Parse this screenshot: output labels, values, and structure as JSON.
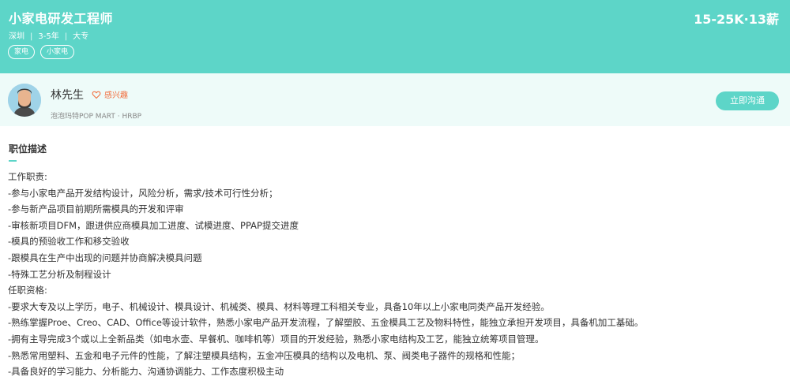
{
  "job": {
    "title": "小家电研发工程师",
    "salary": "15-25K·13薪",
    "city": "深圳",
    "experience": "3-5年",
    "education": "大专",
    "meta_separator": "|",
    "tags": [
      "家电",
      "小家电"
    ]
  },
  "recruiter": {
    "name": "林先生",
    "interest_label": "感兴趣",
    "company": "泡泡玛特POP MART",
    "role_separator": "·",
    "role": "HRBP",
    "chat_button": "立即沟通"
  },
  "description": {
    "heading": "职位描述",
    "lines": [
      "工作职责:",
      "-参与小家电产品开发结构设计，风险分析，需求/技术可行性分析；",
      "-参与新产品项目前期所需模具的开发和评审",
      "-审核新项目DFM，跟进供应商模具加工进度、试模进度、PPAP提交进度",
      "-模具的预验收工作和移交验收",
      "-跟模具在生产中出现的问题并协商解决模具问题",
      "-特殊工艺分析及制程设计",
      "任职资格:",
      "-要求大专及以上学历，电子、机械设计、模具设计、机械类、模具、材料等理工科相关专业，具备10年以上小家电同类产品开发经验。",
      "-熟练掌握Proe、Creo、CAD、Office等设计软件，熟悉小家电产品开发流程，了解塑胶、五金模具工艺及物料特性，能独立承担开发项目，具备机加工基础。",
      "-拥有主导完成3个或以上全新品类（如电水壶、早餐机、咖啡机等）项目的开发经验，熟悉小家电结构及工艺，能独立统筹项目管理。",
      "-熟悉常用塑料、五金和电子元件的性能，了解注塑模具结构，五金冲压模具的结构以及电机、泵、阀类电子器件的规格和性能；",
      "-具备良好的学习能力、分析能力、沟通协调能力、工作态度积极主动"
    ]
  },
  "colors": {
    "accent": "#5dd5c8",
    "recruiter_bg": "#eefbf9",
    "interest": "#f26b3a"
  },
  "icons": {
    "avatar": "avatar-icon",
    "interest": "heart-icon"
  }
}
